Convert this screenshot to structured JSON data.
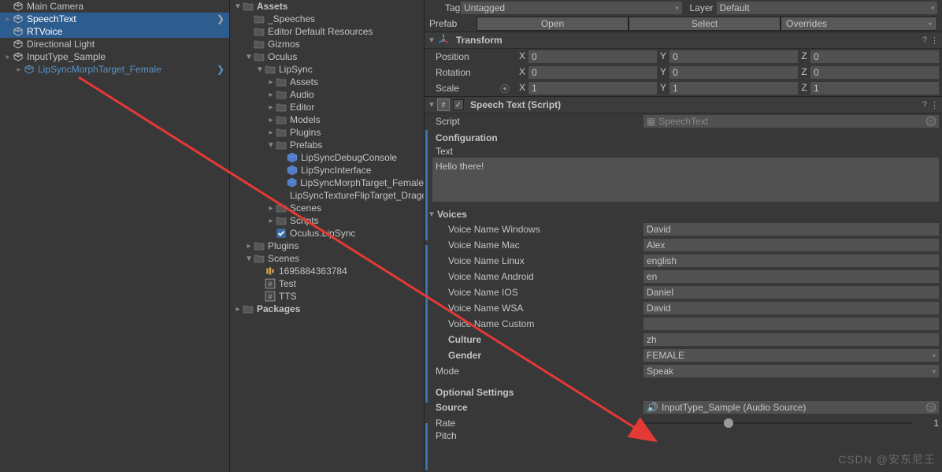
{
  "hierarchy": {
    "items": [
      {
        "name": "Main Camera",
        "indent": 1
      },
      {
        "name": "SpeechText",
        "indent": 1,
        "selected": true,
        "hasChildren": true
      },
      {
        "name": "RTVoice",
        "indent": 1,
        "selected": true
      },
      {
        "name": "Directional Light",
        "indent": 1
      },
      {
        "name": "InputType_Sample",
        "indent": 1,
        "hasChildren": true
      },
      {
        "name": "LipSyncMorphTarget_Female",
        "indent": 2,
        "linked": true,
        "hasChildren": true
      }
    ]
  },
  "project": {
    "tree": [
      {
        "label": "Assets",
        "type": "folder",
        "open": true,
        "depth": 0
      },
      {
        "label": "_Speeches",
        "type": "folder",
        "depth": 1
      },
      {
        "label": "Editor Default Resources",
        "type": "folder",
        "depth": 1
      },
      {
        "label": "Gizmos",
        "type": "folder",
        "depth": 1
      },
      {
        "label": "Oculus",
        "type": "folder",
        "open": true,
        "depth": 1
      },
      {
        "label": "LipSync",
        "type": "folder",
        "open": true,
        "depth": 2
      },
      {
        "label": "Assets",
        "type": "folder",
        "hasChildren": true,
        "depth": 3
      },
      {
        "label": "Audio",
        "type": "folder",
        "hasChildren": true,
        "depth": 3
      },
      {
        "label": "Editor",
        "type": "folder",
        "hasChildren": true,
        "depth": 3
      },
      {
        "label": "Models",
        "type": "folder",
        "hasChildren": true,
        "depth": 3
      },
      {
        "label": "Plugins",
        "type": "folder",
        "hasChildren": true,
        "depth": 3
      },
      {
        "label": "Prefabs",
        "type": "folder",
        "open": true,
        "depth": 3
      },
      {
        "label": "LipSyncDebugConsole",
        "type": "prefab",
        "depth": 4
      },
      {
        "label": "LipSyncInterface",
        "type": "prefab",
        "depth": 4
      },
      {
        "label": "LipSyncMorphTarget_Female",
        "type": "prefab",
        "depth": 4
      },
      {
        "label": "LipSyncTextureFlipTarget_Dragon",
        "type": "prefab",
        "depth": 4
      },
      {
        "label": "Scenes",
        "type": "folder",
        "hasChildren": true,
        "depth": 3
      },
      {
        "label": "Scripts",
        "type": "folder",
        "hasChildren": true,
        "depth": 3
      },
      {
        "label": "Oculus.LipSync",
        "type": "asmdef",
        "depth": 3
      },
      {
        "label": "Plugins",
        "type": "folder",
        "hasChildren": true,
        "depth": 1
      },
      {
        "label": "Scenes",
        "type": "folder",
        "open": true,
        "depth": 1
      },
      {
        "label": "1695884363784",
        "type": "audio",
        "depth": 2
      },
      {
        "label": "Test",
        "type": "scene",
        "depth": 2
      },
      {
        "label": "TTS",
        "type": "scene",
        "depth": 2
      },
      {
        "label": "Packages",
        "type": "folder",
        "hasChildren": true,
        "depth": 0
      }
    ]
  },
  "inspector": {
    "tag_label": "Tag",
    "tag_value": "Untagged",
    "layer_label": "Layer",
    "layer_value": "Default",
    "prefab_label": "Prefab",
    "prefab_open": "Open",
    "prefab_select": "Select",
    "prefab_overrides": "Overrides",
    "transform": {
      "title": "Transform",
      "position": {
        "label": "Position",
        "x": "0",
        "y": "0",
        "z": "0"
      },
      "rotation": {
        "label": "Rotation",
        "x": "0",
        "y": "0",
        "z": "0"
      },
      "scale": {
        "label": "Scale",
        "x": "1",
        "y": "1",
        "z": "1"
      }
    },
    "speechtext": {
      "title": "Speech Text (Script)",
      "script_label": "Script",
      "script_value": "SpeechText",
      "config_label": "Configuration",
      "text_label": "Text",
      "text_value": "Hello there!",
      "voices_label": "Voices",
      "voice_win_label": "Voice Name Windows",
      "voice_win": "David",
      "voice_mac_label": "Voice Name Mac",
      "voice_mac": "Alex",
      "voice_linux_label": "Voice Name Linux",
      "voice_linux": "english",
      "voice_android_label": "Voice Name Android",
      "voice_android": "en",
      "voice_ios_label": "Voice Name IOS",
      "voice_ios": "Daniel",
      "voice_wsa_label": "Voice Name WSA",
      "voice_wsa": "David",
      "voice_custom_label": "Voice Name Custom",
      "voice_custom": "",
      "culture_label": "Culture",
      "culture": "zh",
      "gender_label": "Gender",
      "gender": "FEMALE",
      "mode_label": "Mode",
      "mode": "Speak",
      "optional_label": "Optional Settings",
      "source_label": "Source",
      "source": "InputType_Sample (Audio Source)",
      "rate_label": "Rate",
      "rate": "1",
      "pitch_label": "Pitch"
    }
  },
  "watermark": "CSDN @安东尼王"
}
